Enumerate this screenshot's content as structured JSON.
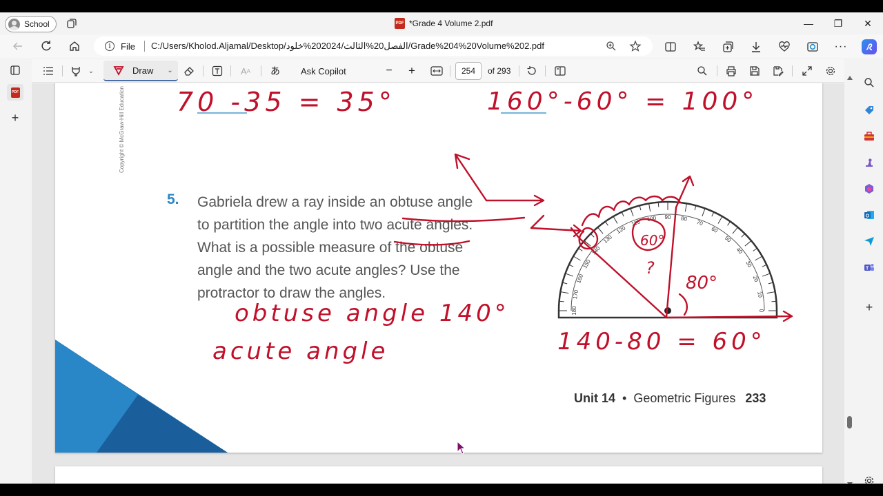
{
  "browser": {
    "profile_label": "School",
    "tab_title": "*Grade 4 Volume 2.pdf",
    "pdf_badge": "PDF",
    "window_controls": {
      "minimize": "—",
      "restore": "❐",
      "close": "✕"
    }
  },
  "address_bar": {
    "scheme_label": "File",
    "url": "C:/Users/Kholod.Aljamal/Desktop/الفصل20%الثالث/202024%خلود/Grade%204%20Volume%202.pdf"
  },
  "pdf_toolbar": {
    "draw_label": "Draw",
    "copilot_label": "Ask Copilot",
    "page_current": "254",
    "page_total": "of 293",
    "zoom_out": "−",
    "zoom_in": "+"
  },
  "document": {
    "copyright": "Copyright © McGraw-Hill Education",
    "question_number": "5.",
    "question_lines": [
      "Gabriela drew a ray inside an obtuse angle",
      "to partition the angle into two acute angles.",
      "What is a possible measure of the obtuse",
      "angle and the two acute angles? Use the",
      "protractor to draw the angles."
    ],
    "footer_unit": "Unit 14",
    "footer_bullet": "•",
    "footer_topic": "Geometric Figures",
    "footer_page": "233",
    "protractor_ticks": [
      "180",
      "170",
      "160",
      "150",
      "140",
      "130",
      "120",
      "110",
      "100",
      "90",
      "80",
      "70",
      "60",
      "50",
      "40",
      "30",
      "20",
      "10",
      "0"
    ],
    "handwriting": {
      "top_left_eq": "70 -35 = 35°",
      "top_right_eq": "160°-60° = 100°",
      "obtuse": "obtuse angle 140°",
      "acute": "acute angle",
      "bottom_eq": "140-80 = 60°",
      "angle_60": "60°",
      "angle_80": "80°",
      "question_mark": "?"
    }
  },
  "colors": {
    "ink_red": "#c0102a",
    "accent_blue": "#2a87c7",
    "corner_blue": "#1f73b7",
    "underline_blue": "#7ab6d9"
  }
}
